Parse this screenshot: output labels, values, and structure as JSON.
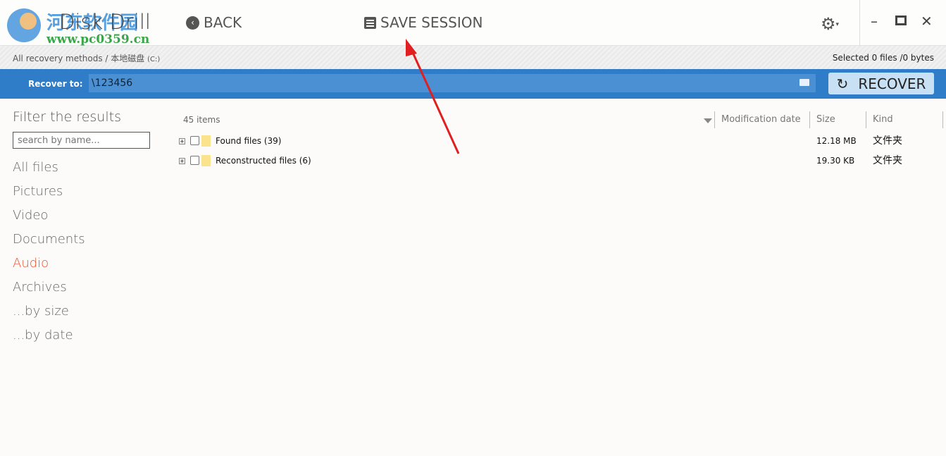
{
  "app": {
    "title": "Disk Drill",
    "watermark_cn": "河东软件园",
    "watermark_url": "www.pc0359.cn"
  },
  "toolbar": {
    "back": "BACK",
    "save_session": "SAVE SESSION"
  },
  "breadcrumb": {
    "path": "All recovery methods / 本地磁盘",
    "drive": "(C:)"
  },
  "selected": "Selected 0 files /0 bytes",
  "recover": {
    "label": "Recover to:",
    "value": "\\123456",
    "button": "RECOVER"
  },
  "sidebar": {
    "title": "Filter the results",
    "search_placeholder": "search by name...",
    "items": [
      {
        "label": "All files"
      },
      {
        "label": "Pictures"
      },
      {
        "label": "Video"
      },
      {
        "label": "Documents"
      },
      {
        "label": "Audio",
        "active": true
      },
      {
        "label": "Archives"
      },
      {
        "label": "...by size"
      },
      {
        "label": "...by date"
      }
    ]
  },
  "list": {
    "count": "45 items",
    "columns": [
      "Modification date",
      "Size",
      "Kind"
    ],
    "rows": [
      {
        "name": "Found files",
        "count": "(39)",
        "size": "12.18 MB",
        "kind": "文件夹"
      },
      {
        "name": "Reconstructed files",
        "count": "(6)",
        "size": "19.30 KB",
        "kind": "文件夹"
      }
    ]
  },
  "colors": {
    "accent": "#2f7cc8",
    "active": "#e8502d",
    "annotation": "#e02020"
  }
}
